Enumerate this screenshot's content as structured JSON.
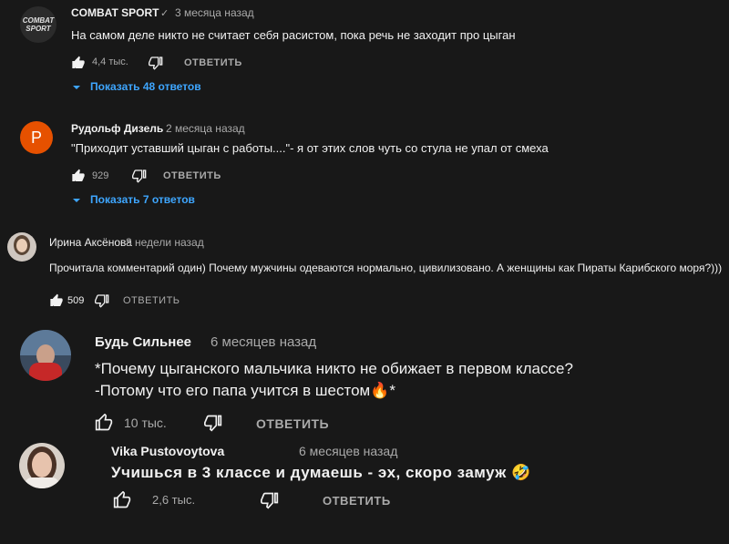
{
  "comments": [
    {
      "author": "COMBAT SPORT",
      "avatar_text": "COMBAT SPORT",
      "verified": true,
      "time": "3 месяца назад",
      "text": "На самом деле никто не считает себя расистом, пока речь не заходит про цыган",
      "likes": "4,4 тыс.",
      "reply_label": "ОТВЕТИТЬ",
      "replies_label": "Показать 48 ответов"
    },
    {
      "author": "Рудольф Дизель",
      "avatar_letter": "P",
      "avatar_color": "#e65100",
      "time": "2 месяца назад",
      "text": "\"Приходит уставший цыган с работы....\"- я от этих слов чуть со стула не упал от смеха",
      "likes": "929",
      "reply_label": "ОТВЕТИТЬ",
      "replies_label": "Показать 7 ответов"
    },
    {
      "author": "Ирина Аксёнова",
      "time": "3 недели назад",
      "text": "Прочитала комментарий один) Почему мужчины одеваются нормально, цивилизовано. А женщины как Пираты Карибского моря?)))",
      "likes": "509",
      "reply_label": "ОТВЕТИТЬ"
    },
    {
      "author": "Будь Сильнее",
      "time": "6 месяцев назад",
      "text_line1": "*Почему цыганского мальчика никто не обижает в первом классе?",
      "text_line2": "-Потому что его папа учится в шестом🔥*",
      "likes": "10 тыс.",
      "reply_label": "ОТВЕТИТЬ"
    },
    {
      "author": "Vika Pustovoytova",
      "time": "6 месяцев назад",
      "text": "Учишься в 3 классе и думаешь - эх, скоро замуж 🤣",
      "likes": "2,6 тыс.",
      "reply_label": "ОТВЕТИТЬ"
    }
  ]
}
